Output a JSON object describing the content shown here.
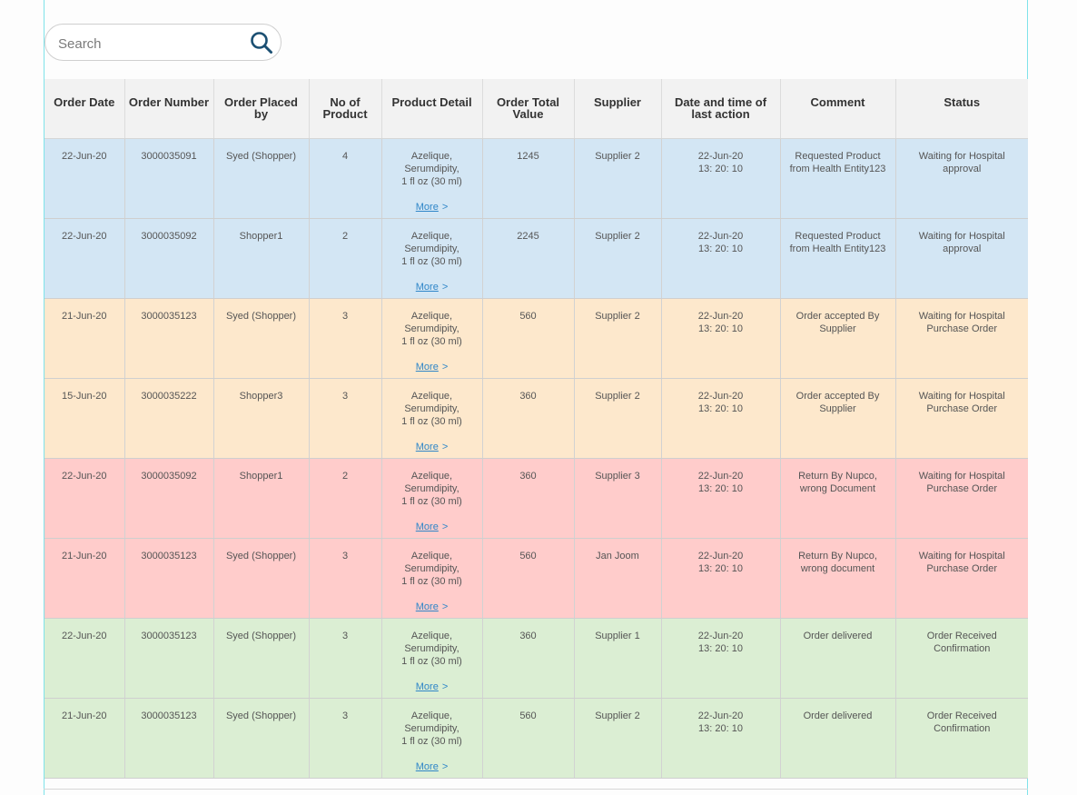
{
  "search": {
    "placeholder": "Search",
    "icon": "search-icon"
  },
  "table": {
    "headers": [
      "Order Date",
      "Order Number",
      "Order Placed by",
      "No of Product",
      "Product Detail",
      "Order Total Value",
      "Supplier",
      "Date and time of last action",
      "Comment",
      "Status"
    ],
    "rows": [
      {
        "tone": "blue",
        "date": "22-Jun-20",
        "number": "3000035091",
        "placed_by": "Syed (Shopper)",
        "count": "4",
        "product": [
          "Azelique,",
          "Serumdipity,",
          "1 fl oz (30 ml)"
        ],
        "more": "More",
        "more_arrow": ">",
        "total": "1245",
        "supplier": "Supplier 2",
        "last_action": [
          "22-Jun-20",
          "13: 20: 10"
        ],
        "comment": "Requested Product from Health Entity123",
        "status": "Waiting for Hospital approval"
      },
      {
        "tone": "blue",
        "date": "22-Jun-20",
        "number": "3000035092",
        "placed_by": "Shopper1",
        "count": "2",
        "product": [
          "Azelique,",
          "Serumdipity,",
          "1 fl oz (30 ml)"
        ],
        "more": "More",
        "more_arrow": ">",
        "total": "2245",
        "supplier": "Supplier 2",
        "last_action": [
          "22-Jun-20",
          "13: 20: 10"
        ],
        "comment": "Requested Product from Health Entity123",
        "status": "Waiting for Hospital approval"
      },
      {
        "tone": "orange",
        "date": "21-Jun-20",
        "number": "3000035123",
        "placed_by": "Syed (Shopper)",
        "count": "3",
        "product": [
          "Azelique,",
          "Serumdipity,",
          "1 fl oz (30 ml)"
        ],
        "more": "More",
        "more_arrow": ">",
        "total": "560",
        "supplier": "Supplier 2",
        "last_action": [
          "22-Jun-20",
          "13: 20: 10"
        ],
        "comment": "Order accepted By Supplier",
        "status": "Waiting for Hospital Purchase Order"
      },
      {
        "tone": "orange",
        "date": "15-Jun-20",
        "number": "3000035222",
        "placed_by": "Shopper3",
        "count": "3",
        "product": [
          "Azelique,",
          "Serumdipity,",
          "1 fl oz (30 ml)"
        ],
        "more": "More",
        "more_arrow": ">",
        "total": "360",
        "supplier": "Supplier 2",
        "last_action": [
          "22-Jun-20",
          "13: 20: 10"
        ],
        "comment": "Order accepted By Supplier",
        "status": "Waiting for Hospital Purchase Order"
      },
      {
        "tone": "red",
        "date": "22-Jun-20",
        "number": "3000035092",
        "placed_by": "Shopper1",
        "count": "2",
        "product": [
          "Azelique,",
          "Serumdipity,",
          "1 fl oz (30 ml)"
        ],
        "more": "More",
        "more_arrow": ">",
        "total": "360",
        "supplier": "Supplier 3",
        "last_action": [
          "22-Jun-20",
          "13: 20: 10"
        ],
        "comment": "Return By Nupco, wrong Document",
        "status": "Waiting for Hospital Purchase Order"
      },
      {
        "tone": "red",
        "date": "21-Jun-20",
        "number": "3000035123",
        "placed_by": "Syed (Shopper)",
        "count": "3",
        "product": [
          "Azelique,",
          "Serumdipity,",
          "1 fl oz (30 ml)"
        ],
        "more": "More",
        "more_arrow": ">",
        "total": "560",
        "supplier": "Jan Joom",
        "last_action": [
          "22-Jun-20",
          "13: 20: 10"
        ],
        "comment": "Return By Nupco, wrong document",
        "status": "Waiting for Hospital Purchase Order"
      },
      {
        "tone": "green",
        "date": "22-Jun-20",
        "number": "3000035123",
        "placed_by": "Syed (Shopper)",
        "count": "3",
        "product": [
          "Azelique,",
          "Serumdipity,",
          "1 fl oz (30 ml)"
        ],
        "more": "More",
        "more_arrow": ">",
        "total": "360",
        "supplier": "Supplier 1",
        "last_action": [
          "22-Jun-20",
          "13: 20: 10"
        ],
        "comment": "Order delivered",
        "status": "Order Received Confirmation"
      },
      {
        "tone": "green",
        "date": "21-Jun-20",
        "number": "3000035123",
        "placed_by": "Syed (Shopper)",
        "count": "3",
        "product": [
          "Azelique,",
          "Serumdipity,",
          "1 fl oz (30 ml)"
        ],
        "more": "More",
        "more_arrow": ">",
        "total": "560",
        "supplier": "Supplier 2",
        "last_action": [
          "22-Jun-20",
          "13: 20: 10"
        ],
        "comment": "Order delivered",
        "status": "Order Received Confirmation"
      }
    ]
  },
  "colors": {
    "blue_row": "#d3e6f4",
    "orange_row": "#fde8cc",
    "red_row": "#ffcccb",
    "green_row": "#dbeed3",
    "link": "#2f86c8",
    "search_icon": "#1b4f72"
  }
}
